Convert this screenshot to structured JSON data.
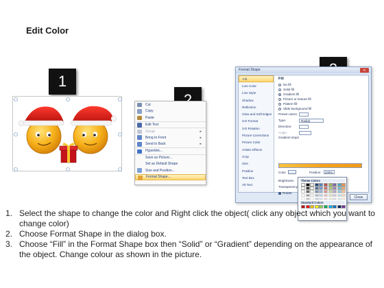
{
  "title": "Edit Color",
  "badges": {
    "one": "1",
    "two": "2",
    "three": "3"
  },
  "context_menu": {
    "items": [
      {
        "label": "Cut",
        "icon": "scissors-icon",
        "color": "#7a8fb0"
      },
      {
        "label": "Copy",
        "icon": "copy-icon",
        "color": "#8aa0c8"
      },
      {
        "label": "Paste",
        "icon": "paste-icon",
        "color": "#b48a3a"
      },
      {
        "label": "Edit Text",
        "icon": "edit-text-icon",
        "color": "#4a6aa8"
      },
      {
        "label": "Group",
        "icon": "group-icon",
        "color": "#c0c8d6",
        "arrow": true,
        "disabled": true
      },
      {
        "label": "Bring to Front",
        "icon": "bring-front-icon",
        "color": "#5f86c9",
        "arrow": true
      },
      {
        "label": "Send to Back",
        "icon": "send-back-icon",
        "color": "#5f86c9",
        "arrow": true
      },
      {
        "label": "Hyperlink...",
        "icon": "hyperlink-icon",
        "color": "#3f73c4"
      },
      {
        "label": "Save as Picture...",
        "icon": "",
        "color": ""
      },
      {
        "label": "Set as Default Shape",
        "icon": "",
        "color": ""
      },
      {
        "label": "Size and Position...",
        "icon": "size-position-icon",
        "color": "#7fa1d6"
      },
      {
        "label": "Format Shape...",
        "icon": "format-shape-icon",
        "color": "#e3a43a",
        "highlighted": true
      }
    ]
  },
  "dialog": {
    "title": "Format Shape",
    "close_label": "Close",
    "nav": [
      "Fill",
      "Line Color",
      "Line Style",
      "Shadow",
      "Reflection",
      "Glow and Soft Edges",
      "3-D Format",
      "3-D Rotation",
      "Picture Corrections",
      "Picture Color",
      "Artistic Effects",
      "Crop",
      "Size",
      "Position",
      "Text Box",
      "Alt Text"
    ],
    "active_nav": "Fill",
    "fill_heading": "Fill",
    "fill_options": [
      {
        "label": "No fill",
        "selected": false
      },
      {
        "label": "Solid fill",
        "selected": false
      },
      {
        "label": "Gradient fill",
        "selected": true
      },
      {
        "label": "Picture or texture fill",
        "selected": false
      },
      {
        "label": "Pattern fill",
        "selected": false
      },
      {
        "label": "Slide background fill",
        "selected": false
      }
    ],
    "preset_colors_label": "Preset colors:",
    "type_label": "Type:",
    "type_value": "Radial",
    "direction_label": "Direction:",
    "angle_label": "Angle:",
    "gradient_stops_label": "Gradient stops",
    "color_label": "Color",
    "position_label": "Position:",
    "position_value": "100%",
    "brightness_label": "Brightness:",
    "transparency_label": "Transparency:",
    "rotate_label": "Rotate",
    "theme_colors_label": "Theme Colors",
    "standard_colors_label": "Standard Colors",
    "theme_colors": [
      "#ffffff",
      "#000000",
      "#eeece1",
      "#1f497d",
      "#4f81bd",
      "#c0504d",
      "#9bbb59",
      "#8064a2",
      "#4bacc6",
      "#f79646"
    ],
    "standard_colors": [
      "#c00000",
      "#ff0000",
      "#ffc000",
      "#ffff00",
      "#92d050",
      "#00b050",
      "#00b0f0",
      "#0070c0",
      "#002060",
      "#7030a0"
    ]
  },
  "steps": [
    {
      "num": "1.",
      "text": "Select the shape to change the color and Right click the object( click any object which you want to change color)"
    },
    {
      "num": "2.",
      "text": "Choose Format Shape in the dialog box."
    },
    {
      "num": "3.",
      "text": "Choose “Fill” in the Format Shape box then “Solid” or “Gradient” depending on the appearance of the object. Change colour as shown in the picture."
    }
  ]
}
